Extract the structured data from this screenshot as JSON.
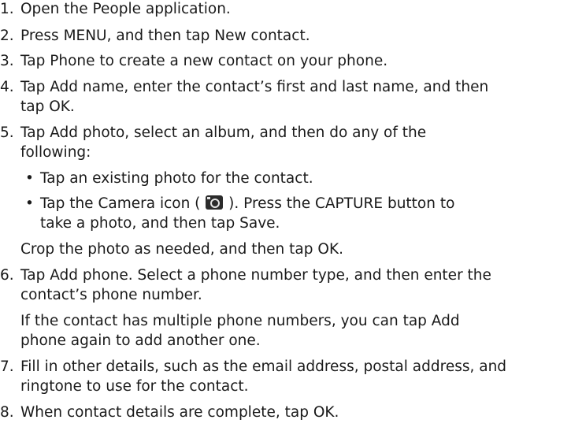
{
  "steps": [
    {
      "num": "1.",
      "parts": [
        "Open the People application."
      ]
    },
    {
      "num": "2.",
      "parts": [
        "Press MENU, and then tap ",
        "New contact",
        "."
      ]
    },
    {
      "num": "3.",
      "parts": [
        "Tap ",
        "Phone",
        " to create a new contact on your phone."
      ]
    },
    {
      "num": "4.",
      "parts": [
        "Tap ",
        "Add name",
        ", enter the contact’s first and last name, and then"
      ],
      "cont": [
        "tap ",
        "OK",
        "."
      ]
    },
    {
      "num": "5.",
      "parts": [
        "Tap ",
        "Add photo",
        ", select an album, and then do any of the"
      ],
      "cont": [
        "following:"
      ]
    },
    {
      "num": "6.",
      "parts": [
        "Tap ",
        "Add phone",
        ". Select a phone number type, and then enter the"
      ],
      "cont": [
        "contact’s phone number."
      ]
    },
    {
      "num": "7.",
      "parts": [
        "Fill in other details, such as the email address, postal address, and"
      ],
      "cont": [
        "ringtone to use for the contact."
      ]
    },
    {
      "num": "8.",
      "parts": [
        "When contact details are complete, tap ",
        "OK",
        "."
      ]
    }
  ],
  "bullets": [
    {
      "parts": [
        "Tap an existing photo for the contact."
      ]
    },
    {
      "parts": [
        "Tap the ",
        "Camera",
        " icon ( ",
        " ). Press the CAPTURE button to"
      ],
      "cont": [
        "take a photo, and then tap ",
        "Save",
        "."
      ]
    }
  ],
  "notes": {
    "crop": [
      "Crop the photo as needed, and then tap ",
      "OK",
      "."
    ],
    "multi_1": [
      "If the contact has multiple phone numbers, you can tap ",
      "Add"
    ],
    "multi_2": [
      "phone",
      " again to add another one."
    ]
  },
  "icons": {
    "camera": "camera-icon"
  },
  "bullet_char": "•"
}
